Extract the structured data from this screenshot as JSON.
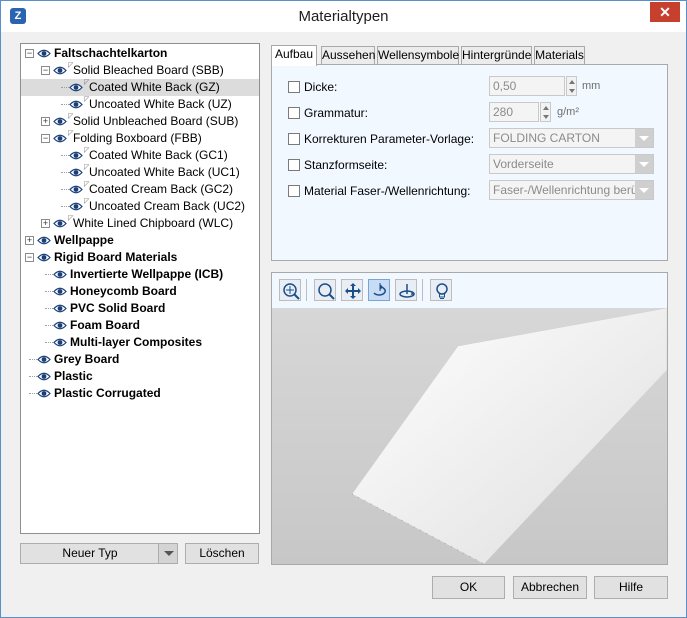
{
  "window": {
    "title": "Materialtypen",
    "close_glyph": "✕",
    "app_icon": "Z"
  },
  "tree": {
    "items": [
      {
        "label": "Faltschachtelkarton",
        "bold": true,
        "depth": 0,
        "expander": "minus"
      },
      {
        "label": "Solid Bleached Board (SBB)",
        "bold": false,
        "depth": 1,
        "expander": "minus"
      },
      {
        "label": "Coated White Back (GZ)",
        "bold": false,
        "depth": 2,
        "expander": "none",
        "selected": true
      },
      {
        "label": "Uncoated White Back (UZ)",
        "bold": false,
        "depth": 2,
        "expander": "none"
      },
      {
        "label": "Solid Unbleached Board (SUB)",
        "bold": false,
        "depth": 1,
        "expander": "plus"
      },
      {
        "label": "Folding Boxboard (FBB)",
        "bold": false,
        "depth": 1,
        "expander": "minus"
      },
      {
        "label": "Coated White Back (GC1)",
        "bold": false,
        "depth": 2,
        "expander": "none"
      },
      {
        "label": "Uncoated White Back (UC1)",
        "bold": false,
        "depth": 2,
        "expander": "none"
      },
      {
        "label": "Coated Cream Back (GC2)",
        "bold": false,
        "depth": 2,
        "expander": "none"
      },
      {
        "label": "Uncoated Cream Back (UC2)",
        "bold": false,
        "depth": 2,
        "expander": "none"
      },
      {
        "label": "White Lined Chipboard (WLC)",
        "bold": false,
        "depth": 1,
        "expander": "plus"
      },
      {
        "label": "Wellpappe",
        "bold": true,
        "depth": 0,
        "expander": "plus"
      },
      {
        "label": "Rigid Board Materials",
        "bold": true,
        "depth": 0,
        "expander": "minus"
      },
      {
        "label": "Invertierte Wellpappe (ICB)",
        "bold": true,
        "depth": 1,
        "expander": "none"
      },
      {
        "label": "Honeycomb Board",
        "bold": true,
        "depth": 1,
        "expander": "none"
      },
      {
        "label": "PVC Solid Board",
        "bold": true,
        "depth": 1,
        "expander": "none"
      },
      {
        "label": "Foam Board",
        "bold": true,
        "depth": 1,
        "expander": "none"
      },
      {
        "label": "Multi-layer Composites",
        "bold": true,
        "depth": 1,
        "expander": "none"
      },
      {
        "label": "Grey Board",
        "bold": true,
        "depth": 0,
        "expander": "none"
      },
      {
        "label": "Plastic",
        "bold": true,
        "depth": 0,
        "expander": "none"
      },
      {
        "label": "Plastic Corrugated",
        "bold": true,
        "depth": 0,
        "expander": "none"
      }
    ]
  },
  "left_buttons": {
    "new_type": "Neuer Typ",
    "delete": "Löschen"
  },
  "tabs": [
    {
      "label": "Aufbau",
      "active": true
    },
    {
      "label": "Aussehen",
      "active": false
    },
    {
      "label": "Wellensymbole",
      "active": false
    },
    {
      "label": "Hintergründe",
      "active": false
    },
    {
      "label": "Materials",
      "active": false
    }
  ],
  "aufbau": {
    "thickness": {
      "label": "Dicke:",
      "value": "0,50",
      "unit": "mm"
    },
    "grammage": {
      "label": "Grammatur:",
      "value": "280",
      "unit": "g/m²"
    },
    "correction_template": {
      "label": "Korrekturen Parameter-Vorlage:",
      "value": "FOLDING CARTON"
    },
    "die_side": {
      "label": "Stanzformseite:",
      "value": "Vorderseite"
    },
    "fiber_direction": {
      "label": "Material Faser-/Wellenrichtung:",
      "value": "Faser-/Wellenrichtung berück"
    }
  },
  "viewer": {
    "tools": [
      {
        "name": "zoom-fit-icon",
        "active": false
      },
      {
        "name": "zoom-icon",
        "active": false
      },
      {
        "name": "pan-icon",
        "active": false
      },
      {
        "name": "rotate-icon",
        "active": true
      },
      {
        "name": "orbit-icon",
        "active": false
      },
      {
        "name": "light-bulb-icon",
        "active": false
      }
    ]
  },
  "footer": {
    "ok": "OK",
    "cancel": "Abbrechen",
    "help": "Hilfe"
  }
}
